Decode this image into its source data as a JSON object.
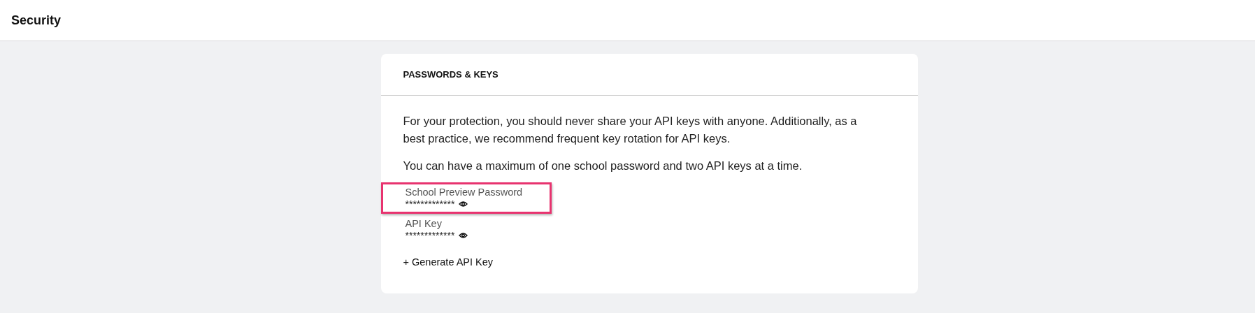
{
  "header": {
    "title": "Security"
  },
  "card": {
    "title": "PASSWORDS & KEYS",
    "paragraphs": [
      "For your protection, you should never share your API keys with anyone. Additionally, as a best practice, we recommend frequent key rotation for API keys.",
      "You can have a maximum of one school password and two API keys at a time."
    ],
    "keys": [
      {
        "label": "School Preview Password",
        "value": "*************",
        "highlighted": true
      },
      {
        "label": "API Key",
        "value": "*************",
        "highlighted": false
      }
    ],
    "action": "+ Generate API Key"
  }
}
